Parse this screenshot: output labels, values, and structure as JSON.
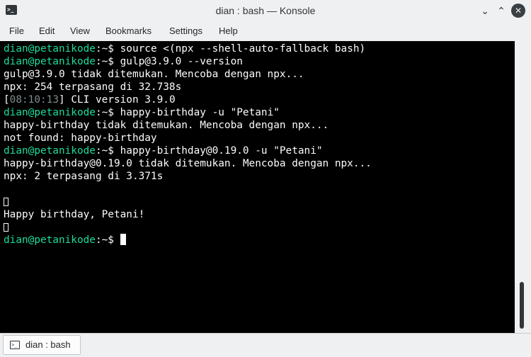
{
  "window": {
    "title": "dian : bash — Konsole",
    "app_icon_glyph": ">_",
    "minimize_glyph": "⌄",
    "maximize_glyph": "⌃",
    "close_glyph": "✕"
  },
  "menu": {
    "file": "File",
    "edit": "Edit",
    "view": "View",
    "bookmarks": "Bookmarks",
    "settings": "Settings",
    "help": "Help"
  },
  "terminal": {
    "prompt": "dian@petanikode",
    "prompt_suffix": ":~$",
    "lines": [
      {
        "type": "cmd",
        "text": " source <(npx --shell-auto-fallback bash)"
      },
      {
        "type": "cmd",
        "text": " gulp@3.9.0 --version"
      },
      {
        "type": "out",
        "text": "gulp@3.9.0 tidak ditemukan. Mencoba dengan npx..."
      },
      {
        "type": "out",
        "text": "npx: 254 terpasang di 32.738s"
      },
      {
        "type": "log",
        "open": "[",
        "time": "08:10:13",
        "close": "]",
        "text": " CLI version 3.9.0"
      },
      {
        "type": "cmd",
        "text": " happy-birthday -u \"Petani\""
      },
      {
        "type": "out",
        "text": "happy-birthday tidak ditemukan. Mencoba dengan npx..."
      },
      {
        "type": "out",
        "text": "not found: happy-birthday"
      },
      {
        "type": "cmd",
        "text": " happy-birthday@0.19.0 -u \"Petani\""
      },
      {
        "type": "out",
        "text": "happy-birthday@0.19.0 tidak ditemukan. Mencoba dengan npx..."
      },
      {
        "type": "out",
        "text": "npx: 2 terpasang di 3.371s"
      },
      {
        "type": "blank",
        "text": ""
      },
      {
        "type": "glyph",
        "text": ""
      },
      {
        "type": "out",
        "text": "Happy birthday, Petani!"
      },
      {
        "type": "glyph",
        "text": ""
      },
      {
        "type": "prompt_cursor",
        "text": " "
      }
    ]
  },
  "tab": {
    "label": "dian : bash",
    "icon_glyph": ">_"
  }
}
